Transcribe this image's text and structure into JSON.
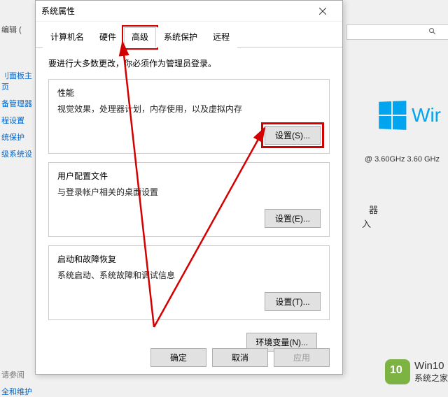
{
  "bg": {
    "leftItems": [
      "刂面板主页",
      "备管理器",
      "程设置",
      "统保护",
      "级系统设",
      "请参阅",
      "全和维护"
    ],
    "editLabel": "编辑 (",
    "searchPlaceholder": "",
    "cpuInfo": "@ 3.60GHz   3.60 GHz",
    "sideLabel1": "器",
    "sideLabel2": "入",
    "watermark": {
      "brand": "Win10",
      "site": "系统之家"
    },
    "winText": "Wir"
  },
  "dialog": {
    "title": "系统属性",
    "tabs": [
      {
        "label": "计算机名",
        "active": false,
        "highlight": false
      },
      {
        "label": "硬件",
        "active": false,
        "highlight": false
      },
      {
        "label": "高级",
        "active": true,
        "highlight": true
      },
      {
        "label": "系统保护",
        "active": false,
        "highlight": false
      },
      {
        "label": "远程",
        "active": false,
        "highlight": false
      }
    ],
    "intro": "要进行大多数更改，你必须作为管理员登录。",
    "groups": {
      "performance": {
        "title": "性能",
        "desc": "视觉效果，处理器计划，内存使用，以及虚拟内存",
        "button": "设置(S)..."
      },
      "userProfile": {
        "title": "用户配置文件",
        "desc": "与登录帐户相关的桌面设置",
        "button": "设置(E)..."
      },
      "startup": {
        "title": "启动和故障恢复",
        "desc": "系统启动、系统故障和调试信息",
        "button": "设置(T)..."
      }
    },
    "envVarButton": "环境变量(N)...",
    "footer": {
      "ok": "确定",
      "cancel": "取消",
      "apply": "应用"
    }
  }
}
